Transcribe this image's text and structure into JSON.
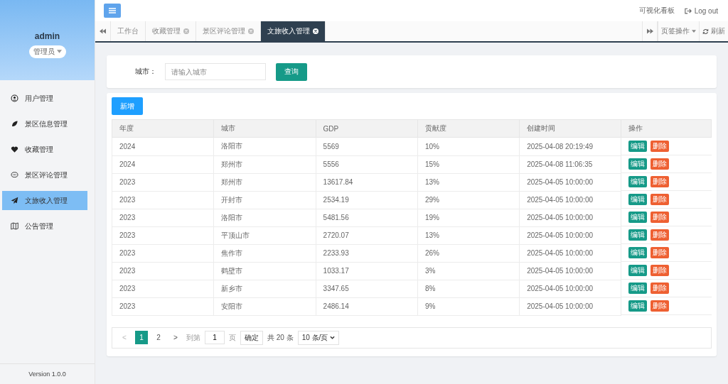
{
  "sidebar": {
    "user": "admin",
    "role": "管理员",
    "items": [
      {
        "label": "用户管理",
        "selected": false
      },
      {
        "label": "景区信息管理",
        "selected": false
      },
      {
        "label": "收藏管理",
        "selected": false
      },
      {
        "label": "景区评论管理",
        "selected": false
      },
      {
        "label": "文旅收入管理",
        "selected": true
      },
      {
        "label": "公告管理",
        "selected": false
      }
    ],
    "version": "Version 1.0.0"
  },
  "header": {
    "links": [
      "可视化看板",
      "Log out"
    ]
  },
  "tabs": [
    {
      "label": "工作台",
      "closable": false,
      "selected": false
    },
    {
      "label": "收藏管理",
      "closable": true,
      "selected": false
    },
    {
      "label": "景区评论管理",
      "closable": true,
      "selected": false
    },
    {
      "label": "文旅收入管理",
      "closable": true,
      "selected": true
    }
  ],
  "tab_actions": [
    "页签操作",
    "刷新"
  ],
  "search": {
    "label": "城市：",
    "placeholder": "请输入城市",
    "button": "查询"
  },
  "add_button": "新增",
  "table": {
    "columns": [
      "年度",
      "城市",
      "GDP",
      "贡献度",
      "创建时间",
      "操作"
    ],
    "rows": [
      {
        "cells": [
          "2024",
          "洛阳市",
          "5569",
          "10%",
          "2025-04-08 20:19:49"
        ],
        "actions": [
          "编辑",
          "删除"
        ]
      },
      {
        "cells": [
          "2024",
          "郑州市",
          "5556",
          "15%",
          "2025-04-08 11:06:35"
        ],
        "actions": [
          "编辑",
          "删除"
        ]
      },
      {
        "cells": [
          "2023",
          "郑州市",
          "13617.84",
          "13%",
          "2025-04-05 10:00:00"
        ],
        "actions": [
          "编辑",
          "删除"
        ]
      },
      {
        "cells": [
          "2023",
          "开封市",
          "2534.19",
          "29%",
          "2025-04-05 10:00:00"
        ],
        "actions": [
          "编辑",
          "删除"
        ]
      },
      {
        "cells": [
          "2023",
          "洛阳市",
          "5481.56",
          "19%",
          "2025-04-05 10:00:00"
        ],
        "actions": [
          "编辑",
          "删除"
        ]
      },
      {
        "cells": [
          "2023",
          "平顶山市",
          "2720.07",
          "13%",
          "2025-04-05 10:00:00"
        ],
        "actions": [
          "编辑",
          "删除"
        ]
      },
      {
        "cells": [
          "2023",
          "焦作市",
          "2233.93",
          "26%",
          "2025-04-05 10:00:00"
        ],
        "actions": [
          "编辑",
          "删除"
        ]
      },
      {
        "cells": [
          "2023",
          "鹤壁市",
          "1033.17",
          "3%",
          "2025-04-05 10:00:00"
        ],
        "actions": [
          "编辑",
          "删除"
        ]
      },
      {
        "cells": [
          "2023",
          "新乡市",
          "3347.65",
          "8%",
          "2025-04-05 10:00:00"
        ],
        "actions": [
          "编辑",
          "删除"
        ]
      },
      {
        "cells": [
          "2023",
          "安阳市",
          "2486.14",
          "9%",
          "2025-04-05 10:00:00"
        ],
        "actions": [
          "编辑",
          "删除"
        ]
      }
    ]
  },
  "pagination": {
    "pages": [
      {
        "label": "1",
        "selected": true
      },
      {
        "label": "2",
        "selected": false
      }
    ],
    "prev": "<",
    "next": ">",
    "goto": "到第",
    "page_value": "1",
    "page_unit": "页",
    "confirm": "确定",
    "total": "共 20 条",
    "page_size": "10 条/页"
  }
}
